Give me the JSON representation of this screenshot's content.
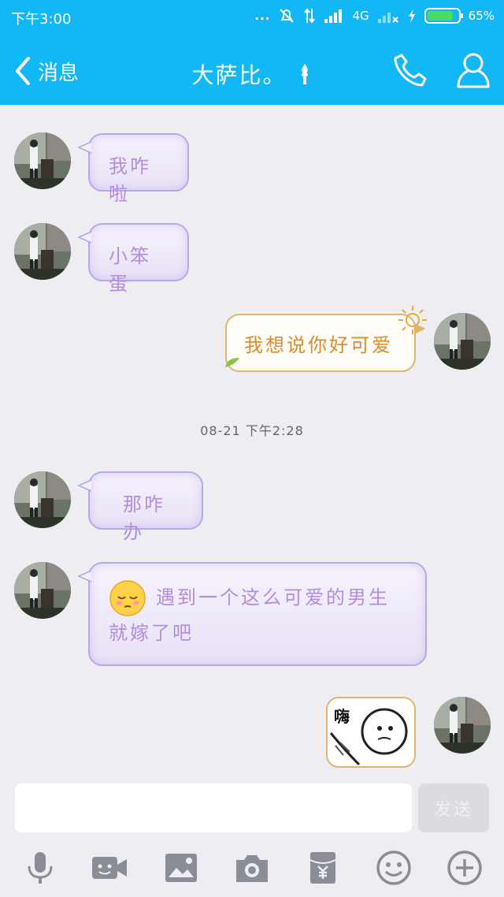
{
  "status_bar": {
    "time": "下午3:00",
    "dots": "...",
    "network": "4G",
    "battery": "65%"
  },
  "header": {
    "back_label": "消息",
    "title": "大萨比。"
  },
  "messages": [
    {
      "side": "left",
      "text": "我咋啦"
    },
    {
      "side": "left",
      "text": "小笨蛋"
    },
    {
      "side": "right",
      "text": "我想说你好可爱"
    },
    {
      "side": "left",
      "text": "那咋办"
    },
    {
      "side": "left",
      "text": "遇到一个这么可爱的男生就嫁了吧"
    },
    {
      "side": "right",
      "sticker_text": "嗨"
    }
  ],
  "timestamp": "08-21 下午2:28",
  "input": {
    "placeholder": "",
    "send_label": "发送"
  },
  "toolbar": {
    "icons": [
      "microphone-icon",
      "video-icon",
      "image-icon",
      "camera-icon",
      "red-packet-icon",
      "emoji-icon",
      "plus-icon"
    ]
  },
  "colors": {
    "header": "#12b7f5",
    "background": "#ededf2",
    "left_bubble_text": "#b28ddb",
    "right_bubble_text": "#e08a2a"
  }
}
